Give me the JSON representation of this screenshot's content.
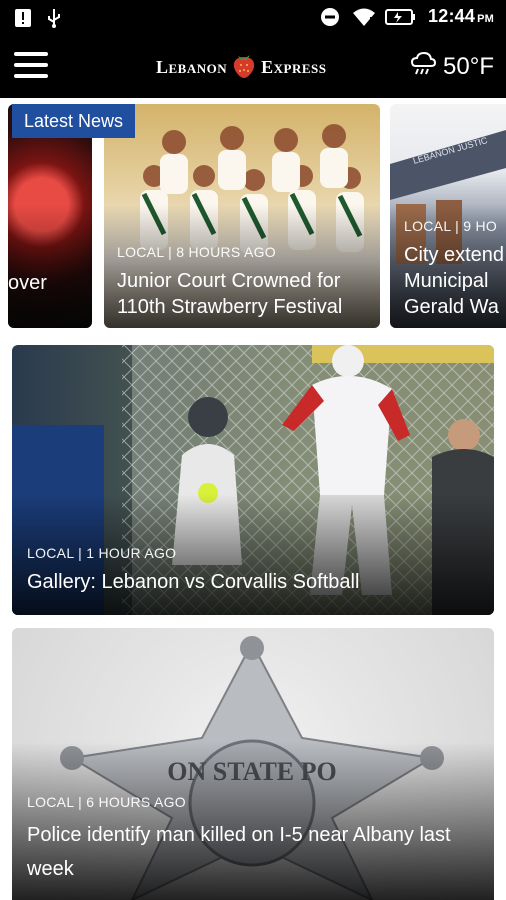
{
  "status_bar": {
    "time": "12:44",
    "ampm": "PM",
    "icons": [
      "alert-icon",
      "usb-icon",
      "do-not-disturb-icon",
      "wifi-icon",
      "battery-icon"
    ]
  },
  "header": {
    "logo_left": "Lebanon",
    "logo_right": "Express",
    "weather_temp": "50°F",
    "menu_icon": "hamburger-icon",
    "weather_icon": "rain-cloud-icon"
  },
  "carousel": {
    "badge": "Latest News",
    "items": [
      {
        "meta": "",
        "headline": "over"
      },
      {
        "meta": "LOCAL | 8 HOURS AGO",
        "headline": "Junior Court Crowned for 110th Strawberry Festival"
      },
      {
        "meta": "LOCAL | 9 HO",
        "headline": "City extend Municipal Gerald Wa"
      }
    ]
  },
  "stories": [
    {
      "meta": "LOCAL | 1 HOUR AGO",
      "headline": "Gallery: Lebanon vs Corvallis Softball"
    },
    {
      "meta": "LOCAL | 6 HOURS AGO",
      "headline": "Police identify man killed on I-5 near Albany last week"
    }
  ],
  "colors": {
    "header_bg": "#000000",
    "badge_bg": "#1f4f9e",
    "logo_accent": "#d63a2c"
  }
}
